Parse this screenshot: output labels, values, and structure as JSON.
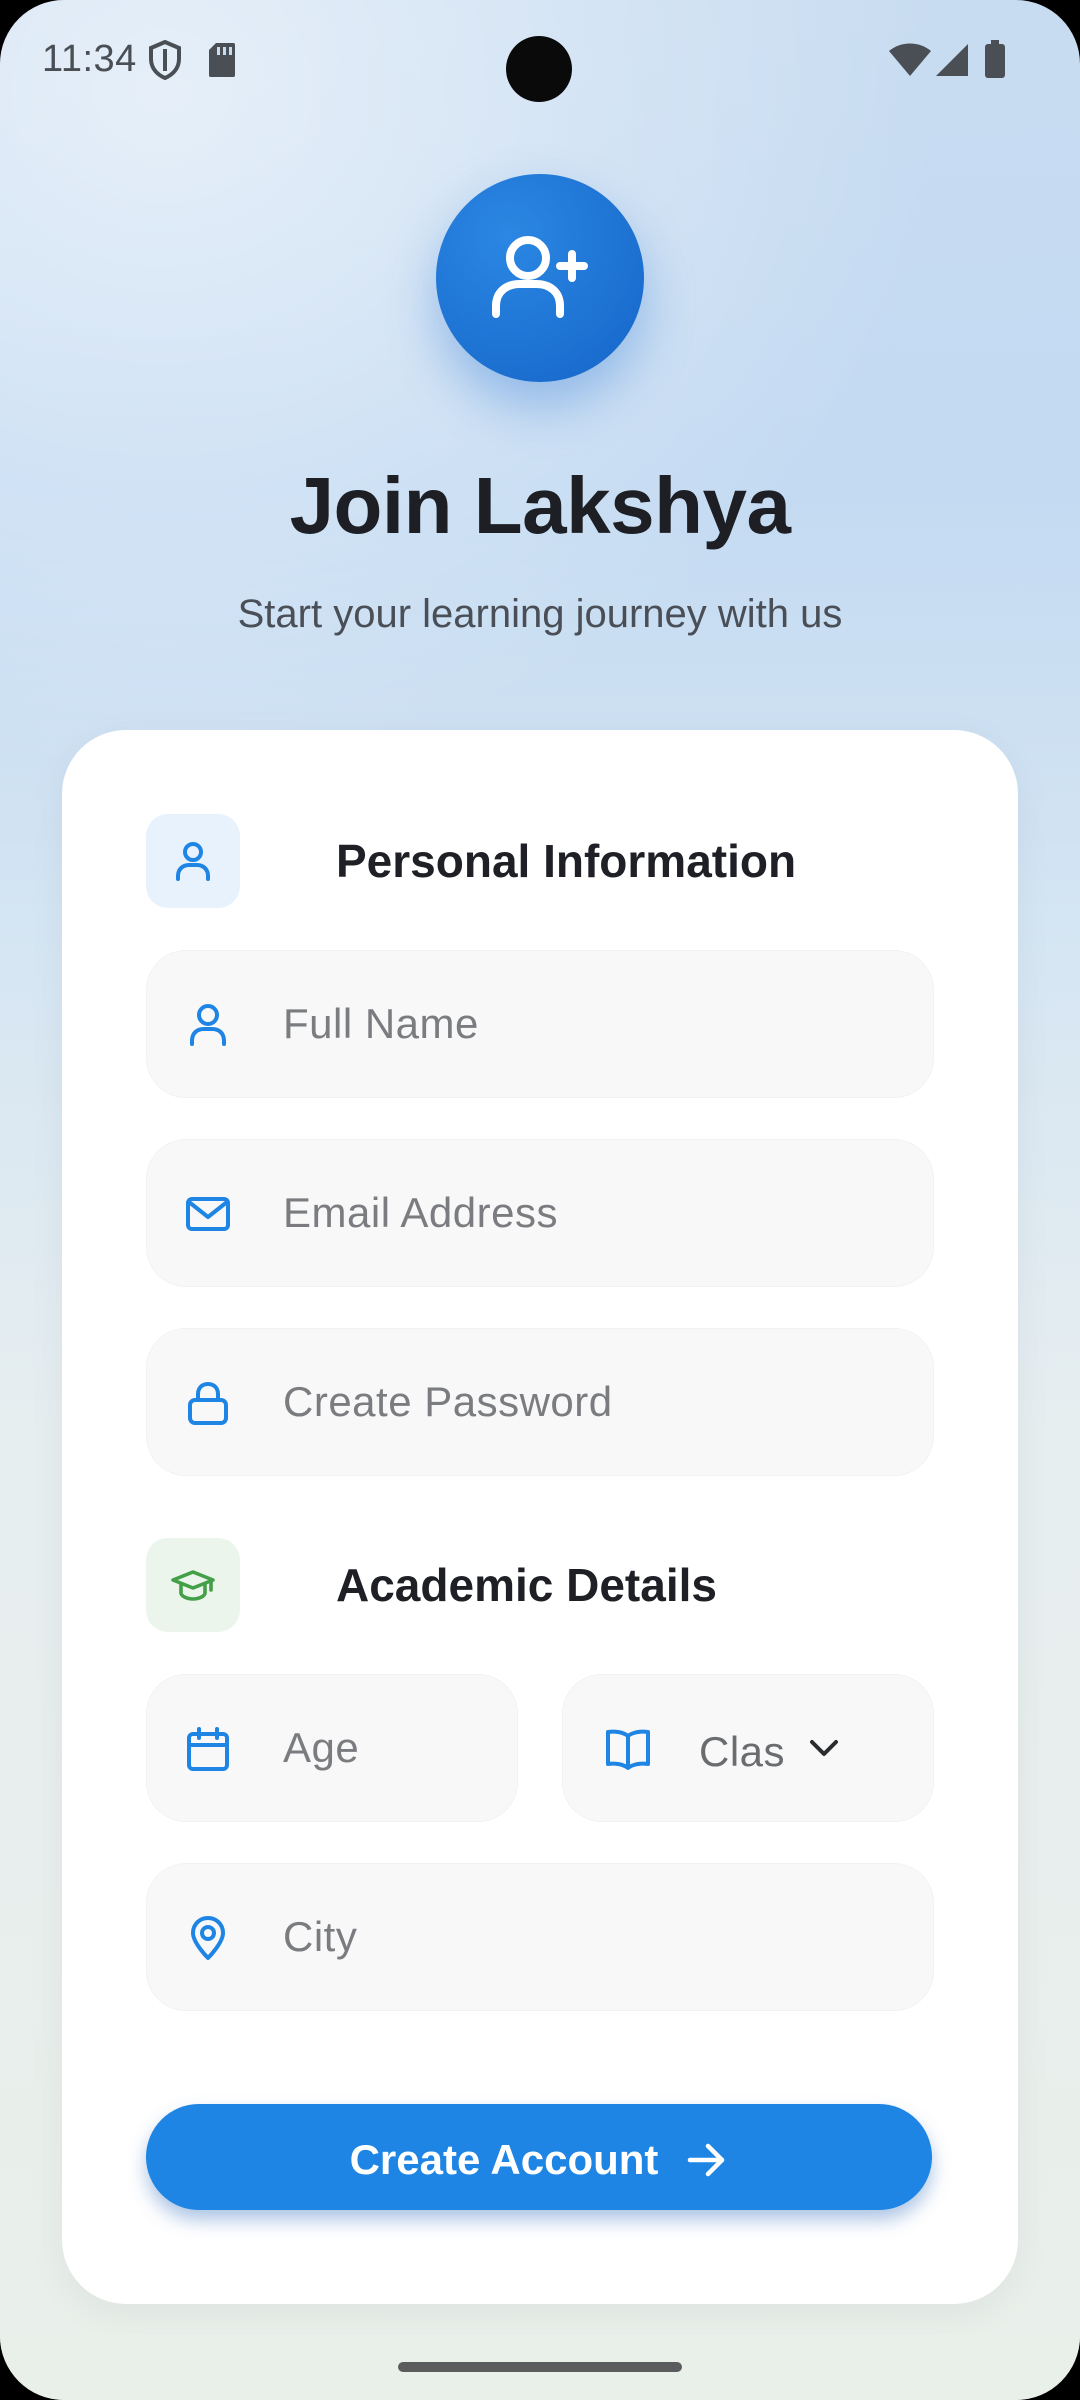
{
  "status_bar": {
    "time": "11:34",
    "icons": [
      "shield-icon",
      "sd-card-icon",
      "wifi-icon",
      "signal-icon",
      "battery-icon"
    ]
  },
  "header": {
    "icon": "user-plus-icon",
    "title": "Join Lakshya",
    "subtitle": "Start your learning journey with us"
  },
  "colors": {
    "primary": "#1e85e4",
    "personal_icon_bg": "#e8f2fc",
    "academic_icon_bg": "#ebf5ec",
    "academic_icon": "#43a047"
  },
  "personal_section": {
    "icon": "person-icon",
    "title": "Personal Information",
    "fields": {
      "full_name": {
        "icon": "person-icon",
        "placeholder": "Full Name"
      },
      "email": {
        "icon": "mail-icon",
        "placeholder": "Email Address"
      },
      "password": {
        "icon": "lock-icon",
        "placeholder": "Create Password"
      }
    }
  },
  "academic_section": {
    "icon": "graduation-cap-icon",
    "title": "Academic Details",
    "fields": {
      "age": {
        "icon": "calendar-icon",
        "placeholder": "Age"
      },
      "class": {
        "icon": "book-icon",
        "value": "Clas"
      },
      "city": {
        "icon": "location-pin-icon",
        "placeholder": "City"
      }
    }
  },
  "submit": {
    "label": "Create Account",
    "icon": "arrow-right-icon"
  }
}
